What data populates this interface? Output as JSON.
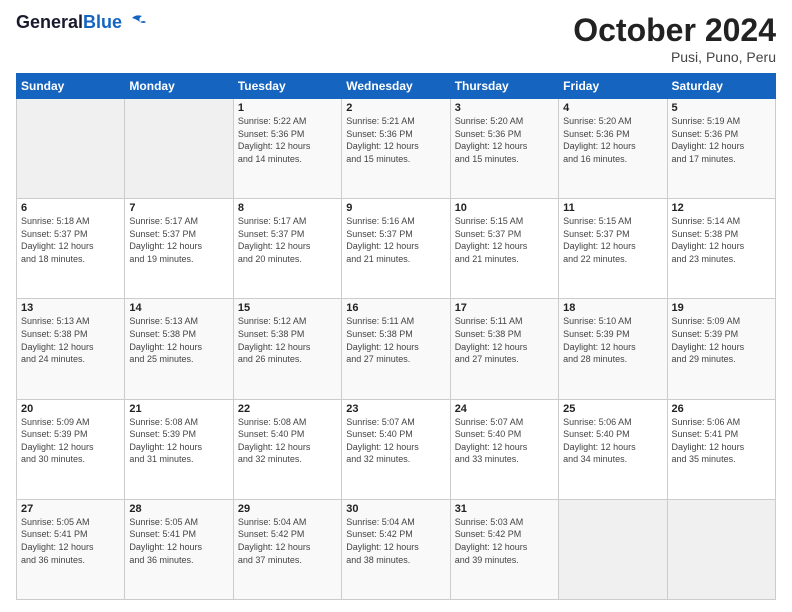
{
  "header": {
    "logo_general": "General",
    "logo_blue": "Blue",
    "month_title": "October 2024",
    "location": "Pusi, Puno, Peru"
  },
  "weekdays": [
    "Sunday",
    "Monday",
    "Tuesday",
    "Wednesday",
    "Thursday",
    "Friday",
    "Saturday"
  ],
  "weeks": [
    [
      {
        "day": "",
        "empty": true
      },
      {
        "day": "",
        "empty": true
      },
      {
        "day": "1",
        "sunrise": "5:22 AM",
        "sunset": "5:36 PM",
        "daylight": "12 hours and 14 minutes."
      },
      {
        "day": "2",
        "sunrise": "5:21 AM",
        "sunset": "5:36 PM",
        "daylight": "12 hours and 15 minutes."
      },
      {
        "day": "3",
        "sunrise": "5:20 AM",
        "sunset": "5:36 PM",
        "daylight": "12 hours and 15 minutes."
      },
      {
        "day": "4",
        "sunrise": "5:20 AM",
        "sunset": "5:36 PM",
        "daylight": "12 hours and 16 minutes."
      },
      {
        "day": "5",
        "sunrise": "5:19 AM",
        "sunset": "5:36 PM",
        "daylight": "12 hours and 17 minutes."
      }
    ],
    [
      {
        "day": "6",
        "sunrise": "5:18 AM",
        "sunset": "5:37 PM",
        "daylight": "12 hours and 18 minutes."
      },
      {
        "day": "7",
        "sunrise": "5:17 AM",
        "sunset": "5:37 PM",
        "daylight": "12 hours and 19 minutes."
      },
      {
        "day": "8",
        "sunrise": "5:17 AM",
        "sunset": "5:37 PM",
        "daylight": "12 hours and 20 minutes."
      },
      {
        "day": "9",
        "sunrise": "5:16 AM",
        "sunset": "5:37 PM",
        "daylight": "12 hours and 21 minutes."
      },
      {
        "day": "10",
        "sunrise": "5:15 AM",
        "sunset": "5:37 PM",
        "daylight": "12 hours and 21 minutes."
      },
      {
        "day": "11",
        "sunrise": "5:15 AM",
        "sunset": "5:37 PM",
        "daylight": "12 hours and 22 minutes."
      },
      {
        "day": "12",
        "sunrise": "5:14 AM",
        "sunset": "5:38 PM",
        "daylight": "12 hours and 23 minutes."
      }
    ],
    [
      {
        "day": "13",
        "sunrise": "5:13 AM",
        "sunset": "5:38 PM",
        "daylight": "12 hours and 24 minutes."
      },
      {
        "day": "14",
        "sunrise": "5:13 AM",
        "sunset": "5:38 PM",
        "daylight": "12 hours and 25 minutes."
      },
      {
        "day": "15",
        "sunrise": "5:12 AM",
        "sunset": "5:38 PM",
        "daylight": "12 hours and 26 minutes."
      },
      {
        "day": "16",
        "sunrise": "5:11 AM",
        "sunset": "5:38 PM",
        "daylight": "12 hours and 27 minutes."
      },
      {
        "day": "17",
        "sunrise": "5:11 AM",
        "sunset": "5:38 PM",
        "daylight": "12 hours and 27 minutes."
      },
      {
        "day": "18",
        "sunrise": "5:10 AM",
        "sunset": "5:39 PM",
        "daylight": "12 hours and 28 minutes."
      },
      {
        "day": "19",
        "sunrise": "5:09 AM",
        "sunset": "5:39 PM",
        "daylight": "12 hours and 29 minutes."
      }
    ],
    [
      {
        "day": "20",
        "sunrise": "5:09 AM",
        "sunset": "5:39 PM",
        "daylight": "12 hours and 30 minutes."
      },
      {
        "day": "21",
        "sunrise": "5:08 AM",
        "sunset": "5:39 PM",
        "daylight": "12 hours and 31 minutes."
      },
      {
        "day": "22",
        "sunrise": "5:08 AM",
        "sunset": "5:40 PM",
        "daylight": "12 hours and 32 minutes."
      },
      {
        "day": "23",
        "sunrise": "5:07 AM",
        "sunset": "5:40 PM",
        "daylight": "12 hours and 32 minutes."
      },
      {
        "day": "24",
        "sunrise": "5:07 AM",
        "sunset": "5:40 PM",
        "daylight": "12 hours and 33 minutes."
      },
      {
        "day": "25",
        "sunrise": "5:06 AM",
        "sunset": "5:40 PM",
        "daylight": "12 hours and 34 minutes."
      },
      {
        "day": "26",
        "sunrise": "5:06 AM",
        "sunset": "5:41 PM",
        "daylight": "12 hours and 35 minutes."
      }
    ],
    [
      {
        "day": "27",
        "sunrise": "5:05 AM",
        "sunset": "5:41 PM",
        "daylight": "12 hours and 36 minutes."
      },
      {
        "day": "28",
        "sunrise": "5:05 AM",
        "sunset": "5:41 PM",
        "daylight": "12 hours and 36 minutes."
      },
      {
        "day": "29",
        "sunrise": "5:04 AM",
        "sunset": "5:42 PM",
        "daylight": "12 hours and 37 minutes."
      },
      {
        "day": "30",
        "sunrise": "5:04 AM",
        "sunset": "5:42 PM",
        "daylight": "12 hours and 38 minutes."
      },
      {
        "day": "31",
        "sunrise": "5:03 AM",
        "sunset": "5:42 PM",
        "daylight": "12 hours and 39 minutes."
      },
      {
        "day": "",
        "empty": true
      },
      {
        "day": "",
        "empty": true
      }
    ]
  ],
  "labels": {
    "sunrise_prefix": "Sunrise: ",
    "sunset_prefix": "Sunset: ",
    "daylight_label": "Daylight: "
  }
}
